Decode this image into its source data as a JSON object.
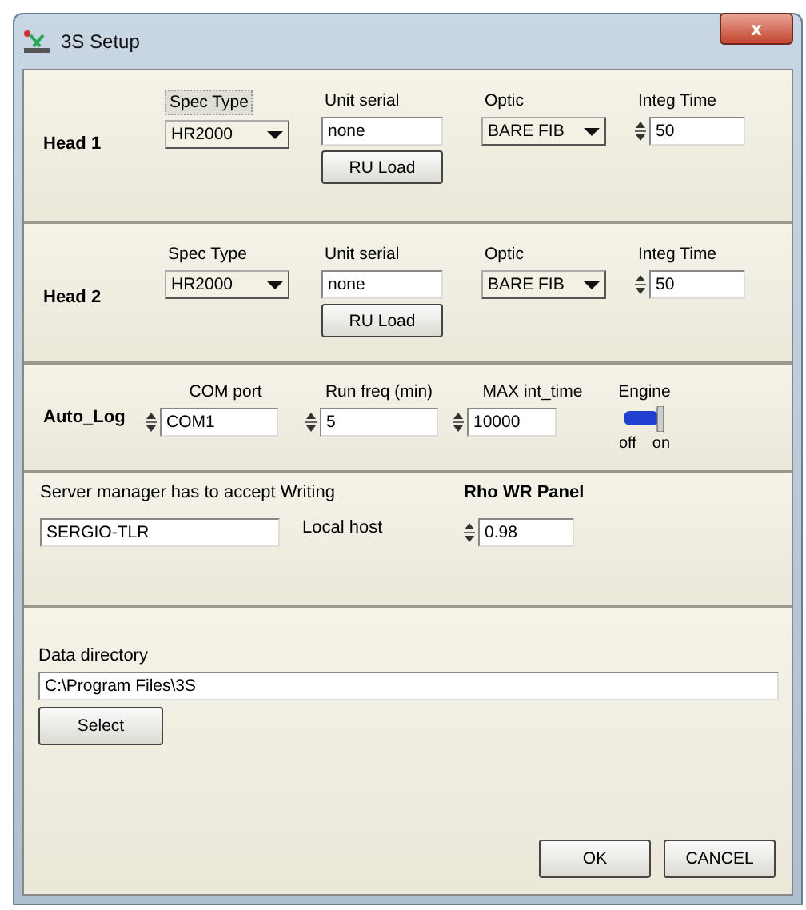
{
  "window": {
    "title": "3S Setup",
    "close": "x"
  },
  "heads": [
    {
      "label": "Head 1",
      "spec_type_label": "Spec Type",
      "spec_label_focused": true,
      "spec_type": "HR2000",
      "unit_serial_label": "Unit serial",
      "unit_serial": "none",
      "load_button": "RU Load",
      "optic_label": "Optic",
      "optic": "BARE FIB",
      "integ_label": "Integ Time",
      "integ": "50"
    },
    {
      "label": "Head 2",
      "spec_type_label": "Spec Type",
      "spec_label_focused": false,
      "spec_type": "HR2000",
      "unit_serial_label": "Unit serial",
      "unit_serial": "none",
      "load_button": "RU Load",
      "optic_label": "Optic",
      "optic": "BARE FIB",
      "integ_label": "Integ Time",
      "integ": "50"
    }
  ],
  "auto_log": {
    "label": "Auto_Log",
    "fields": [
      {
        "label": "COM port",
        "value": "COM1"
      },
      {
        "label": "Run freq (min)",
        "value": "5"
      },
      {
        "label": "MAX int_time",
        "value": "10000"
      }
    ],
    "engine": {
      "label": "Engine",
      "off": "off",
      "on_label": "on",
      "on": true
    }
  },
  "server": {
    "note": "Server manager has to accept Writing",
    "host": "SERGIO-TLR",
    "host_label": "Local host",
    "rho_label": "Rho WR Panel",
    "rho": "0.98"
  },
  "data_directory": {
    "label": "Data directory",
    "path": "C:\\Program Files\\3S",
    "select_button": "Select"
  },
  "buttons": [
    "OK",
    "CANCEL"
  ]
}
